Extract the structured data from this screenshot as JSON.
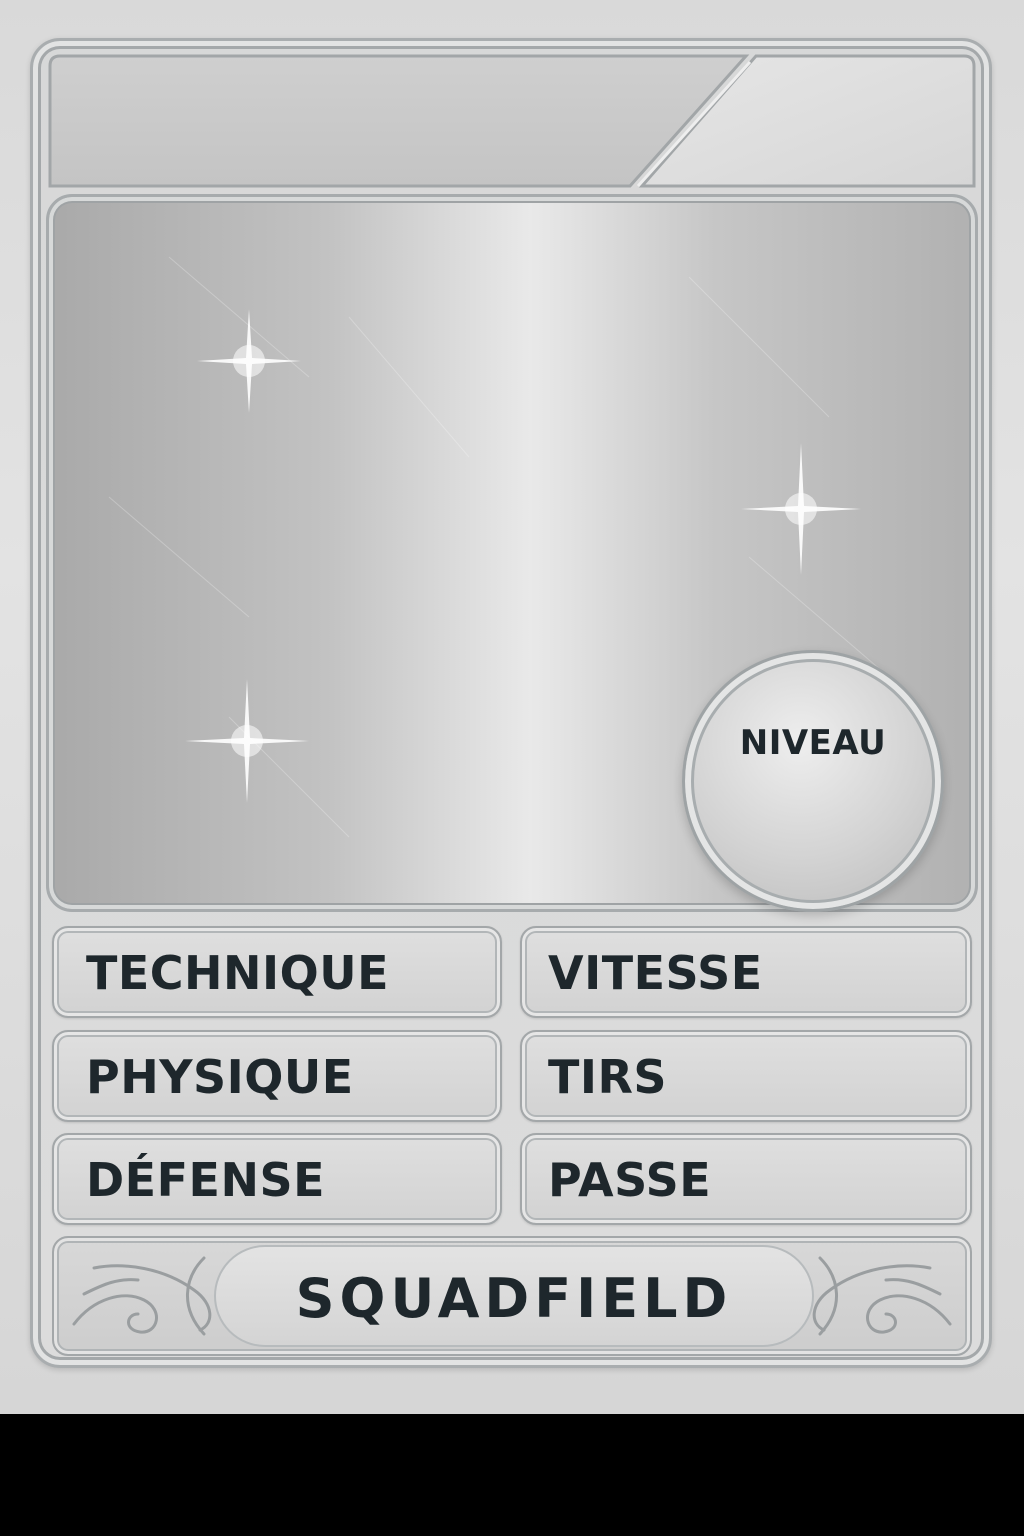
{
  "card": {
    "level_label": "NIVEAU",
    "stats": [
      {
        "label": "TECHNIQUE"
      },
      {
        "label": "VITESSE"
      },
      {
        "label": "PHYSIQUE"
      },
      {
        "label": "TIRS"
      },
      {
        "label": "DÉFENSE"
      },
      {
        "label": "PASSE"
      }
    ],
    "brand": "SQUADFIELD",
    "icons": [
      "sparkle-icon",
      "ornament-scroll-icon"
    ],
    "colors": {
      "text": "#1e272c",
      "metal_light": "#e9e9e9",
      "metal_dark": "#a9a9a9",
      "frame": "#a9adaf"
    }
  }
}
